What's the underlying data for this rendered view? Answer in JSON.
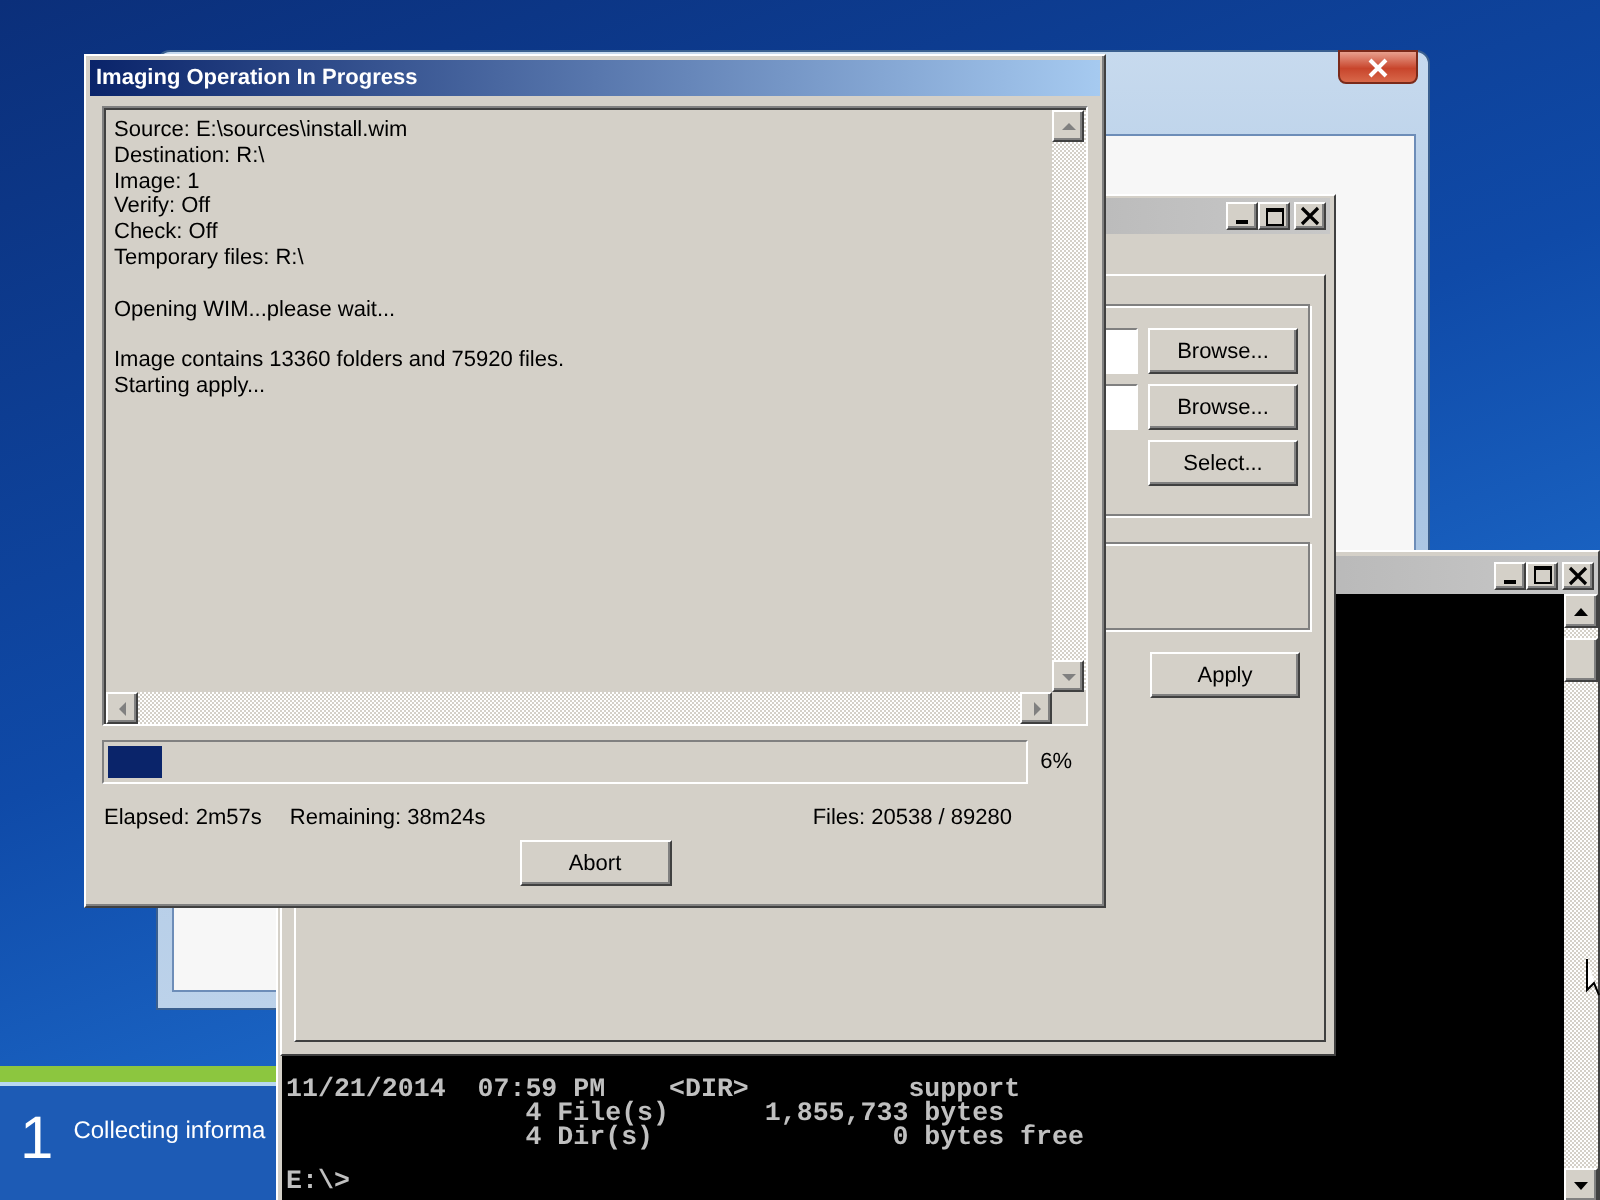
{
  "setup_window": {
    "step_number": "1",
    "status_text": "Collecting informa"
  },
  "console_window": {
    "lines": [
      "11/21/2014  07:59 PM    <DIR>          support",
      "               4 File(s)      1,855,733 bytes",
      "               4 Dir(s)               0 bytes free"
    ],
    "prompt": "E:\\>"
  },
  "options_window": {
    "buttons": [
      "Browse...",
      "Browse...",
      "Select..."
    ],
    "apply_button": "Apply"
  },
  "imaging_dialog": {
    "title": "Imaging Operation In Progress",
    "log": [
      [
        "Source: E:\\sources\\install.wim",
        "Destination: R:\\",
        "Image: 1",
        "Verify: Off",
        "Check: Off",
        "Temporary files: R:\\"
      ],
      [
        "Opening WIM...please wait..."
      ],
      [
        "Image contains 13360 folders and 75920 files.",
        "Starting apply..."
      ]
    ],
    "progress": {
      "level": 0.06,
      "percent": "6%"
    },
    "elapsed": "Elapsed: 2m57s",
    "remaining": "Remaining: 38m24s",
    "files": "Files: 20538 / 89280",
    "abort_button": "Abort"
  }
}
